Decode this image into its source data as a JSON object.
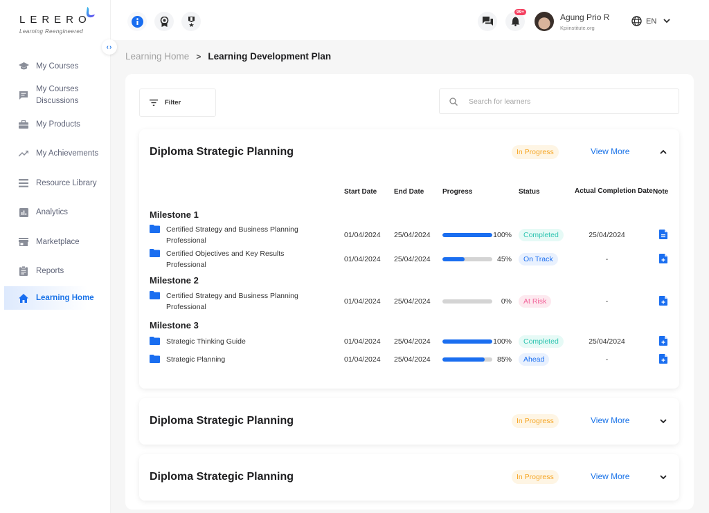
{
  "brand": {
    "name": "LERERO",
    "tagline": "Learning Reengineered"
  },
  "sidebar": {
    "items": [
      {
        "label": "My Courses",
        "icon": "graduation-cap-icon"
      },
      {
        "label": "My Courses Discussions",
        "icon": "chat-icon"
      },
      {
        "label": "My Products",
        "icon": "briefcase-icon"
      },
      {
        "label": "My Achievements",
        "icon": "trending-up-icon"
      },
      {
        "label": "Resource Library",
        "icon": "list-icon"
      },
      {
        "label": "Analytics",
        "icon": "bar-chart-icon"
      },
      {
        "label": "Marketplace",
        "icon": "store-icon"
      },
      {
        "label": "Reports",
        "icon": "clipboard-icon"
      },
      {
        "label": "Learning Home",
        "icon": "home-icon",
        "active": true
      }
    ]
  },
  "topbar": {
    "icons": [
      "info-icon",
      "badge-icon",
      "medal-icon"
    ],
    "notification_count": "99+",
    "user": {
      "name": "Agung Prio R",
      "org": "Kpiinstitute.org"
    },
    "language": "EN"
  },
  "breadcrumb": {
    "previous": "Learning Home",
    "current": "Learning Development Plan"
  },
  "filter": {
    "label": "Filter"
  },
  "search": {
    "placeholder": "Search for learners",
    "value": ""
  },
  "colors": {
    "accent": "#1a6ef0",
    "in_progress": "#f5a524",
    "completed": "#2ec4b0",
    "at_risk": "#f2639a"
  },
  "table": {
    "columns": [
      "Start Date",
      "End Date",
      "Progress",
      "Status",
      "Actual Completion Date",
      "Note"
    ]
  },
  "plans": [
    {
      "title": "Diploma Strategic Planning",
      "status": "In Progress",
      "view_more": "View More",
      "expanded": true,
      "milestones": [
        {
          "name": "Milestone 1",
          "items": [
            {
              "name": "Certified Strategy and Business Planning Professional",
              "start": "01/04/2024",
              "end": "25/04/2024",
              "progress": 100,
              "progress_label": "100%",
              "status": "Completed",
              "completion": "25/04/2024",
              "note": "note-icon"
            },
            {
              "name": "Certified Objectives and Key Results Professional",
              "start": "01/04/2024",
              "end": "25/04/2024",
              "progress": 45,
              "progress_label": "45%",
              "status": "On Track",
              "completion": "-",
              "note": "add-note-icon"
            }
          ]
        },
        {
          "name": "Milestone 2",
          "items": [
            {
              "name": "Certified Strategy and Business Planning Professional",
              "start": "01/04/2024",
              "end": "25/04/2024",
              "progress": 0,
              "progress_label": "0%",
              "status": "At Risk",
              "completion": "-",
              "note": "add-note-icon"
            }
          ]
        },
        {
          "name": "Milestone 3",
          "items": [
            {
              "name": "Strategic Thinking Guide",
              "start": "01/04/2024",
              "end": "25/04/2024",
              "progress": 100,
              "progress_label": "100%",
              "status": "Completed",
              "completion": "25/04/2024",
              "note": "add-note-icon"
            },
            {
              "name": "Strategic Planning",
              "start": "01/04/2024",
              "end": "25/04/2024",
              "progress": 85,
              "progress_label": "85%",
              "status": "Ahead",
              "completion": "-",
              "note": "add-note-icon"
            }
          ]
        }
      ]
    },
    {
      "title": "Diploma Strategic Planning",
      "status": "In Progress",
      "view_more": "View More",
      "expanded": false
    },
    {
      "title": "Diploma Strategic Planning",
      "status": "In Progress",
      "view_more": "View More",
      "expanded": false
    }
  ]
}
